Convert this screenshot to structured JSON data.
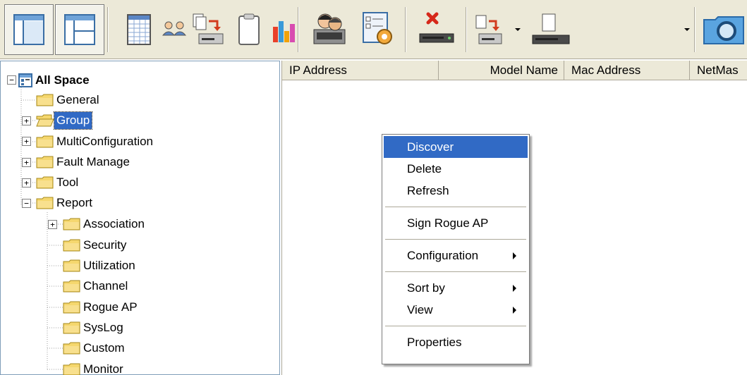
{
  "toolbar": {
    "buttons": [
      {
        "icon": "layout-view-1-icon",
        "pressed": true
      },
      {
        "icon": "layout-view-2-icon",
        "pressed": false
      },
      {
        "icon": "table-grid-icon",
        "pressed": false
      },
      {
        "icon": "users-group-icon",
        "pressed": false
      },
      {
        "icon": "copy-to-device-icon",
        "pressed": false
      },
      {
        "icon": "clipboard-icon",
        "pressed": false
      },
      {
        "icon": "bar-chart-icon",
        "pressed": false
      },
      {
        "icon": "user-computer-icon",
        "pressed": false
      },
      {
        "icon": "configure-form-icon",
        "pressed": false
      },
      {
        "icon": "delete-device-icon",
        "pressed": false
      },
      {
        "icon": "transfer-to-device-icon",
        "pressed": false
      },
      {
        "icon": "document-device-icon",
        "pressed": false
      },
      {
        "icon": "folder-search-icon",
        "pressed": false
      }
    ]
  },
  "tree": {
    "root": {
      "label": "All Space",
      "expander": "−"
    },
    "nodes": [
      {
        "label": "General",
        "expander": ""
      },
      {
        "label": "Group",
        "expander": "+",
        "selected": true
      },
      {
        "label": "MultiConfiguration",
        "expander": "+"
      },
      {
        "label": "Fault Manage",
        "expander": "+"
      },
      {
        "label": "Tool",
        "expander": "+"
      },
      {
        "label": "Report",
        "expander": "−"
      }
    ],
    "report_children": [
      {
        "label": "Association",
        "expander": "+"
      },
      {
        "label": "Security",
        "expander": ""
      },
      {
        "label": "Utilization",
        "expander": ""
      },
      {
        "label": "Channel",
        "expander": ""
      },
      {
        "label": "Rogue AP",
        "expander": ""
      },
      {
        "label": "SysLog",
        "expander": ""
      },
      {
        "label": "Custom",
        "expander": ""
      },
      {
        "label": "Monitor",
        "expander": ""
      }
    ]
  },
  "list": {
    "columns": [
      "IP Address",
      "Model Name",
      "Mac Address",
      "NetMas"
    ]
  },
  "context_menu": {
    "items": [
      {
        "label": "Discover",
        "highlight": true
      },
      {
        "label": "Delete"
      },
      {
        "label": "Refresh"
      },
      {
        "separator": true
      },
      {
        "label": "Sign Rogue AP"
      },
      {
        "separator": true
      },
      {
        "label": "Configuration",
        "submenu": true
      },
      {
        "separator": true
      },
      {
        "label": "Sort by",
        "submenu": true
      },
      {
        "label": "View",
        "submenu": true
      },
      {
        "separator": true
      },
      {
        "label": "Properties"
      }
    ]
  },
  "colors": {
    "selection": "#316ac5",
    "toolbar_bg": "#ece9d8",
    "folder_yellow": "#f5d76e"
  }
}
